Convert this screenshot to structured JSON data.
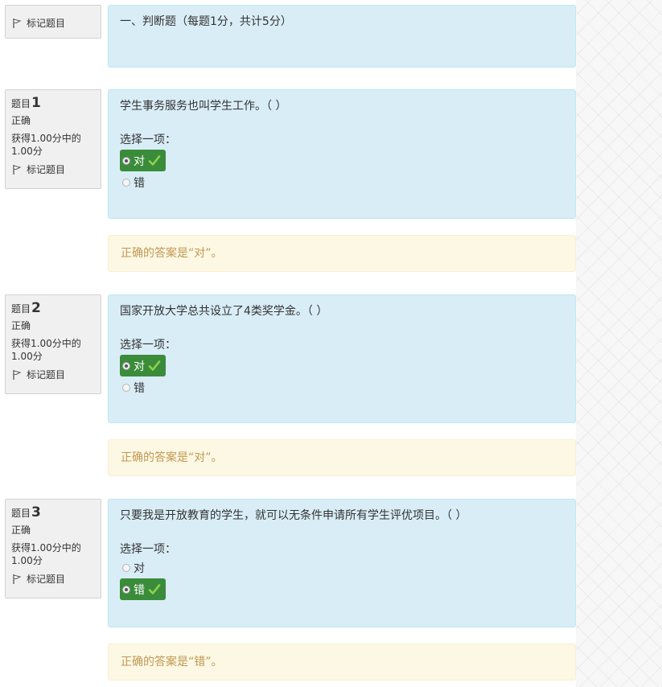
{
  "section": {
    "flag_label": "标记题目",
    "header_text": "一、判断题（每题1分，共计5分）"
  },
  "questions": [
    {
      "qno_prefix": "题目",
      "qno_number": "1",
      "state": "正确",
      "grade": "获得1.00分中的1.00分",
      "flag_label": "标记题目",
      "text": "学生事务服务也叫学生工作。（ ）",
      "prompt": "选择一项：",
      "options": [
        {
          "label": "对",
          "selected": true,
          "correct": true
        },
        {
          "label": "错",
          "selected": false,
          "correct": false
        }
      ],
      "feedback": "正确的答案是“对”。"
    },
    {
      "qno_prefix": "题目",
      "qno_number": "2",
      "state": "正确",
      "grade": "获得1.00分中的1.00分",
      "flag_label": "标记题目",
      "text": "国家开放大学总共设立了4类奖学金。（ ）",
      "prompt": "选择一项：",
      "options": [
        {
          "label": "对",
          "selected": true,
          "correct": true
        },
        {
          "label": "错",
          "selected": false,
          "correct": false
        }
      ],
      "feedback": "正确的答案是“对”。"
    },
    {
      "qno_prefix": "题目",
      "qno_number": "3",
      "state": "正确",
      "grade": "获得1.00分中的1.00分",
      "flag_label": "标记题目",
      "text": "只要我是开放教育的学生，就可以无条件申请所有学生评优项目。（ ）",
      "prompt": "选择一项：",
      "options": [
        {
          "label": "对",
          "selected": false,
          "correct": false
        },
        {
          "label": "错",
          "selected": true,
          "correct": true
        }
      ],
      "feedback": "正确的答案是“错”。"
    }
  ],
  "icons": {
    "flag": "flag-icon",
    "check": "checkmark-icon"
  },
  "colors": {
    "formulation_bg": "#d9edf7",
    "feedback_bg": "#fcf8e3",
    "feedback_text": "#c09853",
    "correct_option_bg": "#3a8c3a",
    "check_color": "#8fd14f"
  }
}
